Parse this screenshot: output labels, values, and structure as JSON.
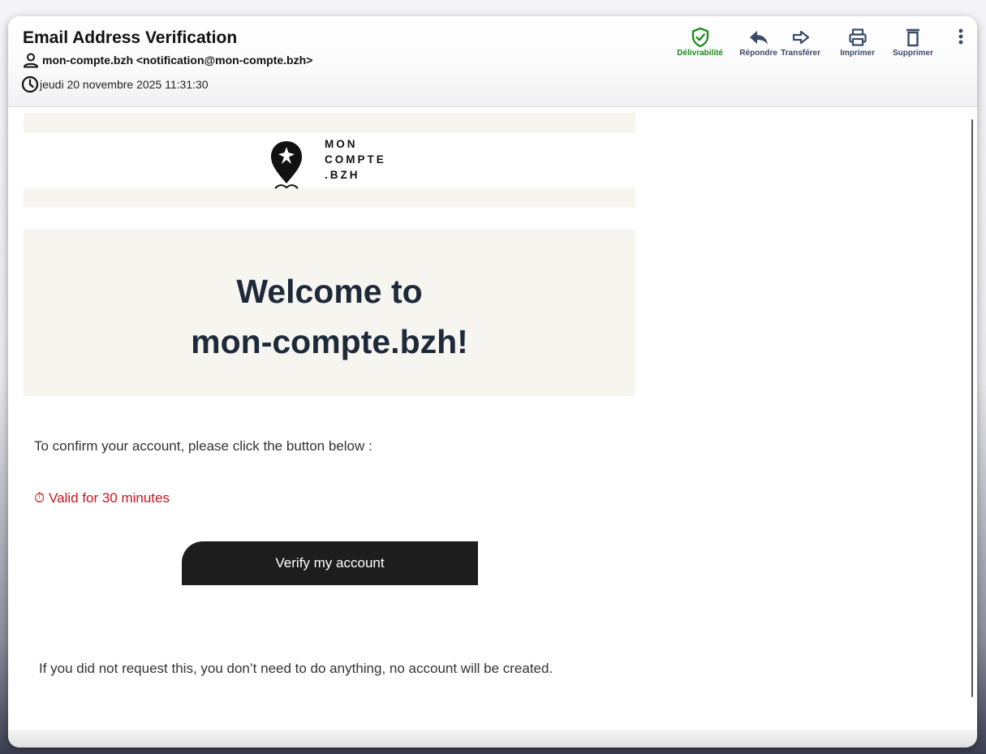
{
  "email": {
    "subject": "Email Address Verification",
    "from": "mon-compte.bzh <notification@mon-compte.bzh>",
    "date": "jeudi 20 novembre 2025 11:31:30"
  },
  "toolbar": {
    "deliverability": "Délivrabilité",
    "reply": "Répondre",
    "forward": "Transférer",
    "print": "Imprimer",
    "delete": "Supprimer"
  },
  "colors": {
    "deliverability_green": "#1a8a1a",
    "toolbar_blue": "#3a4a66",
    "warning_red": "#c8161e",
    "button_dark": "#1d1d1d",
    "panel_beige": "#f6f5f0"
  },
  "logo": {
    "line1": "MON",
    "line2": "COMPTE",
    "line3": ".BZH"
  },
  "body": {
    "welcome_line1": "Welcome to",
    "welcome_line2": "mon-compte.bzh!",
    "instruction": "To confirm your account, please click the button below :",
    "validity_icon": "⏱",
    "validity": "Valid for 30 minutes",
    "button_label": "Verify my account",
    "footnote": "If you did not request this, you don’t need to do anything, no account will be created."
  }
}
